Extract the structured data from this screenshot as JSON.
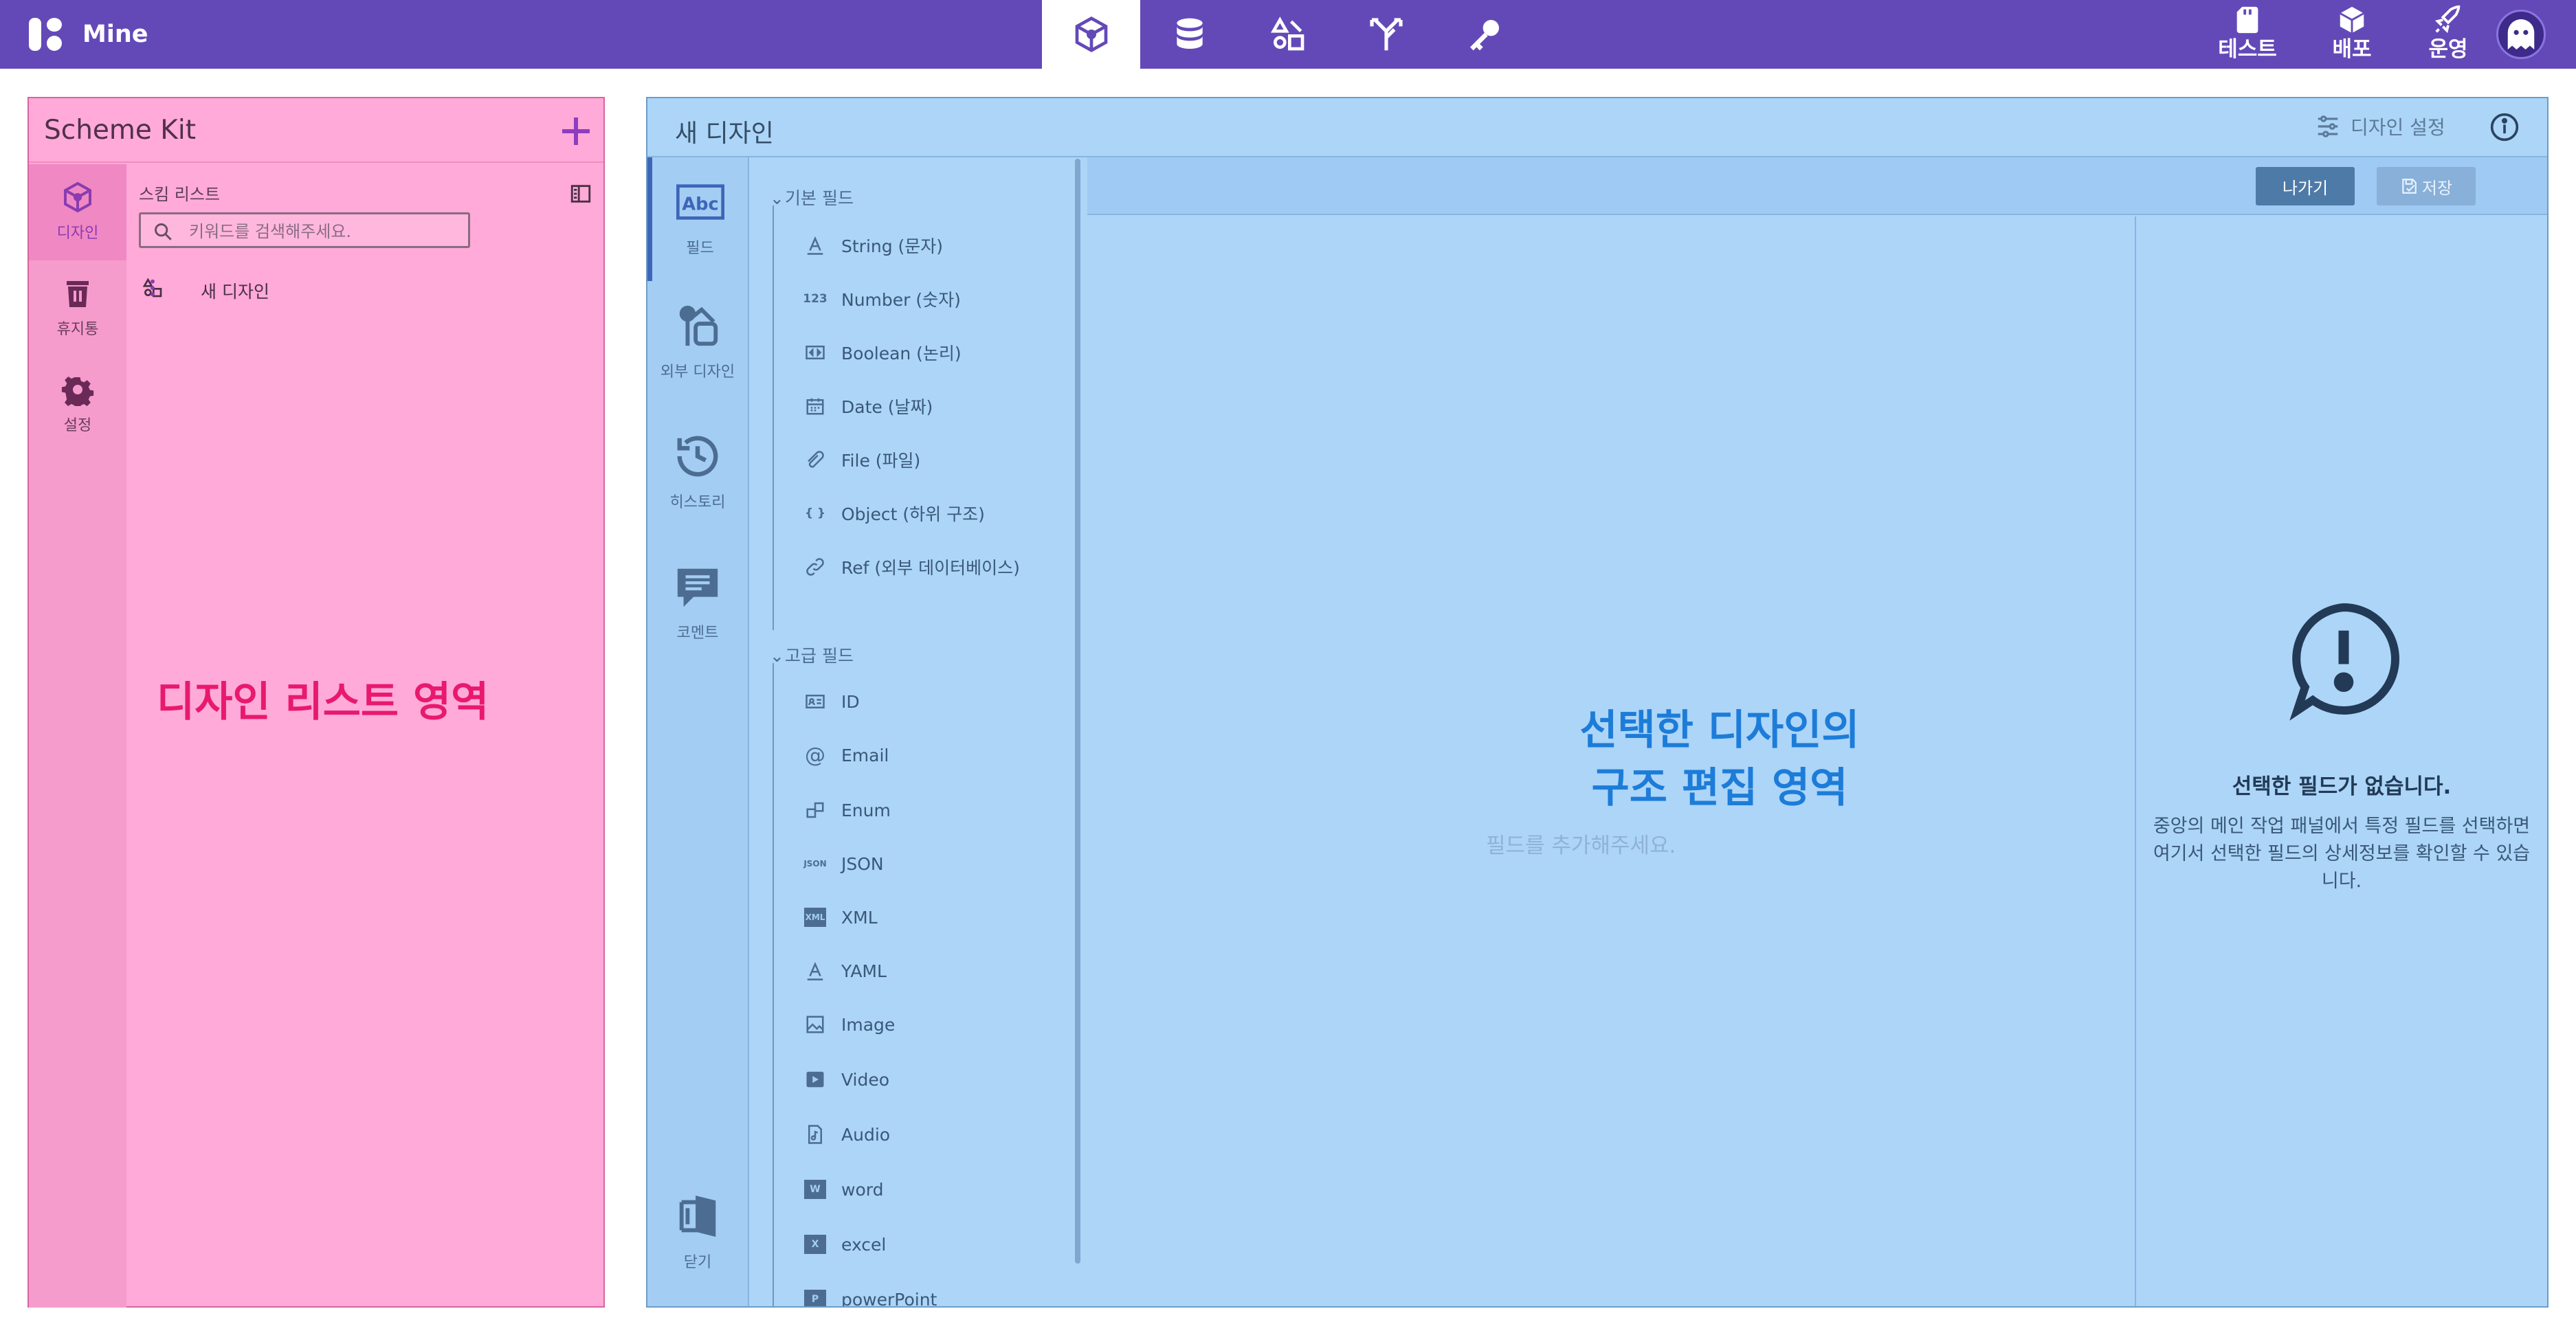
{
  "app": {
    "name": "Mine"
  },
  "topnav": {
    "icons": [
      "scheme-kit-icon",
      "database-icon",
      "shapes-icon",
      "branch-icon",
      "key-icon"
    ],
    "right": [
      {
        "label": "테스트",
        "icon": "sd-card-icon"
      },
      {
        "label": "배포",
        "icon": "package-icon"
      },
      {
        "label": "운영",
        "icon": "rocket-icon"
      }
    ]
  },
  "left_panel": {
    "title": "Scheme Kit",
    "rail": [
      {
        "label": "디자인",
        "icon": "scheme-kit-icon"
      },
      {
        "label": "휴지통",
        "icon": "trash-icon"
      },
      {
        "label": "설정",
        "icon": "gear-icon"
      }
    ],
    "list_header": "스킴 리스트",
    "search_placeholder": "키워드를 검색해주세요.",
    "items": [
      {
        "name": "새 디자인"
      }
    ],
    "annotation": "디자인 리스트 영역"
  },
  "main_panel": {
    "title": "새 디자인",
    "settings_label": "디자인 설정",
    "rail": [
      {
        "label": "필드",
        "icon": "abc-text-icon"
      },
      {
        "label": "외부 디자인",
        "icon": "external-design-icon"
      },
      {
        "label": "히스토리",
        "icon": "history-icon"
      },
      {
        "label": "코멘트",
        "icon": "comment-icon"
      },
      {
        "label": "닫기",
        "icon": "close-panel-icon"
      }
    ],
    "groups": [
      {
        "title": "기본 필드",
        "items": [
          {
            "label": "String (문자)",
            "icon": "A"
          },
          {
            "label": "Number (숫자)",
            "icon": "123"
          },
          {
            "label": "Boolean (논리)",
            "icon": "bool"
          },
          {
            "label": "Date (날짜)",
            "icon": "cal"
          },
          {
            "label": "File (파일)",
            "icon": "clip"
          },
          {
            "label": "Object (하위 구조)",
            "icon": "{}"
          },
          {
            "label": "Ref (외부 데이터베이스)",
            "icon": "link"
          }
        ]
      },
      {
        "title": "고급 필드",
        "items": [
          {
            "label": "ID",
            "icon": "id"
          },
          {
            "label": "Email",
            "icon": "@"
          },
          {
            "label": "Enum",
            "icon": "enum"
          },
          {
            "label": "JSON",
            "icon": "JSON"
          },
          {
            "label": "XML",
            "icon": "XML"
          },
          {
            "label": "YAML",
            "icon": "A"
          },
          {
            "label": "Image",
            "icon": "img"
          },
          {
            "label": "Video",
            "icon": "vid"
          },
          {
            "label": "Audio",
            "icon": "aud"
          },
          {
            "label": "word",
            "icon": "W"
          },
          {
            "label": "excel",
            "icon": "X"
          },
          {
            "label": "powerPoint",
            "icon": "P"
          }
        ]
      }
    ],
    "buttons": {
      "exit": "나가기",
      "save": "저장"
    },
    "editor_placeholder": "필드를 추가해주세요.",
    "annotation": "선택한 디자인의\n구조 편집 영역",
    "detail": {
      "title": "선택한 필드가 없습니다.",
      "description": "중앙의 메인 작업 패널에서 특정 필드를 선택하면 여기서 선택한 필드의 상세정보를 확인할 수 있습니다."
    }
  },
  "colors": {
    "topbar": "#6349b8",
    "left_panel": "#ffaad8",
    "main_panel": "#acd5f8",
    "left_annotation": "#e8196e",
    "main_annotation": "#1d7cd8"
  }
}
